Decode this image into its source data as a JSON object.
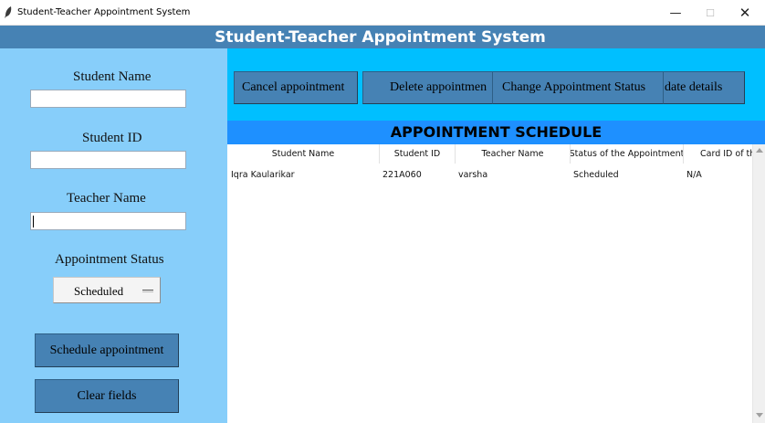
{
  "window": {
    "title": "Student-Teacher Appointment System",
    "minimize_glyph": "—",
    "maximize_glyph": "☐",
    "close_glyph": "✕"
  },
  "header": {
    "title": "Student-Teacher Appointment System",
    "color": "#4682b4"
  },
  "form": {
    "student_name_label": "Student Name",
    "student_name_value": "",
    "student_id_label": "Student ID",
    "student_id_value": "",
    "teacher_name_label": "Teacher Name",
    "teacher_name_value": "",
    "status_label": "Appointment Status",
    "status_value": "Scheduled",
    "schedule_button": "Schedule appointment",
    "clear_button": "Clear fields",
    "panel_color": "#87cefa"
  },
  "toolbar": {
    "cancel_label": "Cancel appointment",
    "delete_label": "Delete appointmen",
    "change_status_label": "Change Appointment Status",
    "update_label": "date details",
    "color": "#00bfff"
  },
  "schedule": {
    "title": "APPOINTMENT SCHEDULE",
    "color": "#1e90ff",
    "columns": [
      "Student Name",
      "Student ID",
      "Teacher Name",
      "Status of the Appointment",
      "Card ID of th"
    ],
    "rows": [
      [
        "Iqra Kaularikar",
        "221A060",
        "varsha",
        "Scheduled",
        "N/A"
      ]
    ]
  },
  "icons": {
    "app": "feather-icon",
    "dropdown": "dropdown-indicator-icon",
    "scroll_up": "scroll-up-arrow-icon",
    "scroll_down": "scroll-down-arrow-icon"
  }
}
